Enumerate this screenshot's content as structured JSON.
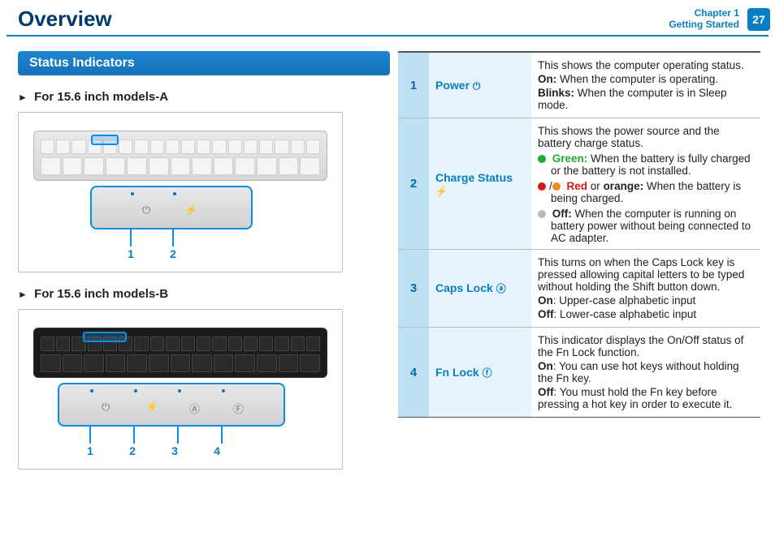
{
  "header": {
    "title": "Overview",
    "chapter_line1": "Chapter 1",
    "chapter_line2": "Getting Started",
    "page_no": "27"
  },
  "section": {
    "title": "Status Indicators",
    "sub_a": "For 15.6 inch models-A",
    "sub_b": "For 15.6 inch models-B"
  },
  "diagramA": {
    "labels": [
      "1",
      "2"
    ]
  },
  "diagramB": {
    "labels": [
      "1",
      "2",
      "3",
      "4"
    ]
  },
  "table": {
    "rows": [
      {
        "num": "1",
        "name": "Power",
        "icon": "⏻",
        "desc_html": "<p>This shows the computer operating status.</p><p><b>On:</b> When the computer is operating.</p><p><b>Blinks:</b> When the computer is in Sleep mode.</p>"
      },
      {
        "num": "2",
        "name": "Charge Status",
        "icon": "⚡",
        "desc_html": "<p>This shows the power source and the battery charge status.</p><span class='indent'><span class='dot green'></span> <b style='color:#1fae2f'>Green:</b> When the battery is fully charged or the battery is not installed.</span><span class='indent'><span class='dot red'></span>/<span class='dot orange'></span> <b style='color:#d21a1a'>Red</b> or <b>orange:</b> When the battery is being charged.</span><span class='indent'><span class='dot grey'></span> <b>Off:</b> When the computer is running on battery power without being connected to AC adapter.</span>"
      },
      {
        "num": "3",
        "name": "Caps Lock",
        "icon": "ⓐ",
        "desc_html": "<p>This turns on when the Caps Lock key is pressed allowing capital letters to be typed without holding the Shift button down.</p><p><b>On</b>: Upper-case alphabetic input</p><p><b>Off</b>: Lower-case alphabetic input</p>"
      },
      {
        "num": "4",
        "name": "Fn Lock",
        "icon": "ⓕ",
        "desc_html": "<p>This indicator displays the On/Off status of the Fn Lock function.</p><p><b>On</b>: You can use hot keys without holding the Fn key.</p><p><b>Off</b>: You must hold the Fn key before pressing a hot key in order to execute it.</p>"
      }
    ]
  }
}
